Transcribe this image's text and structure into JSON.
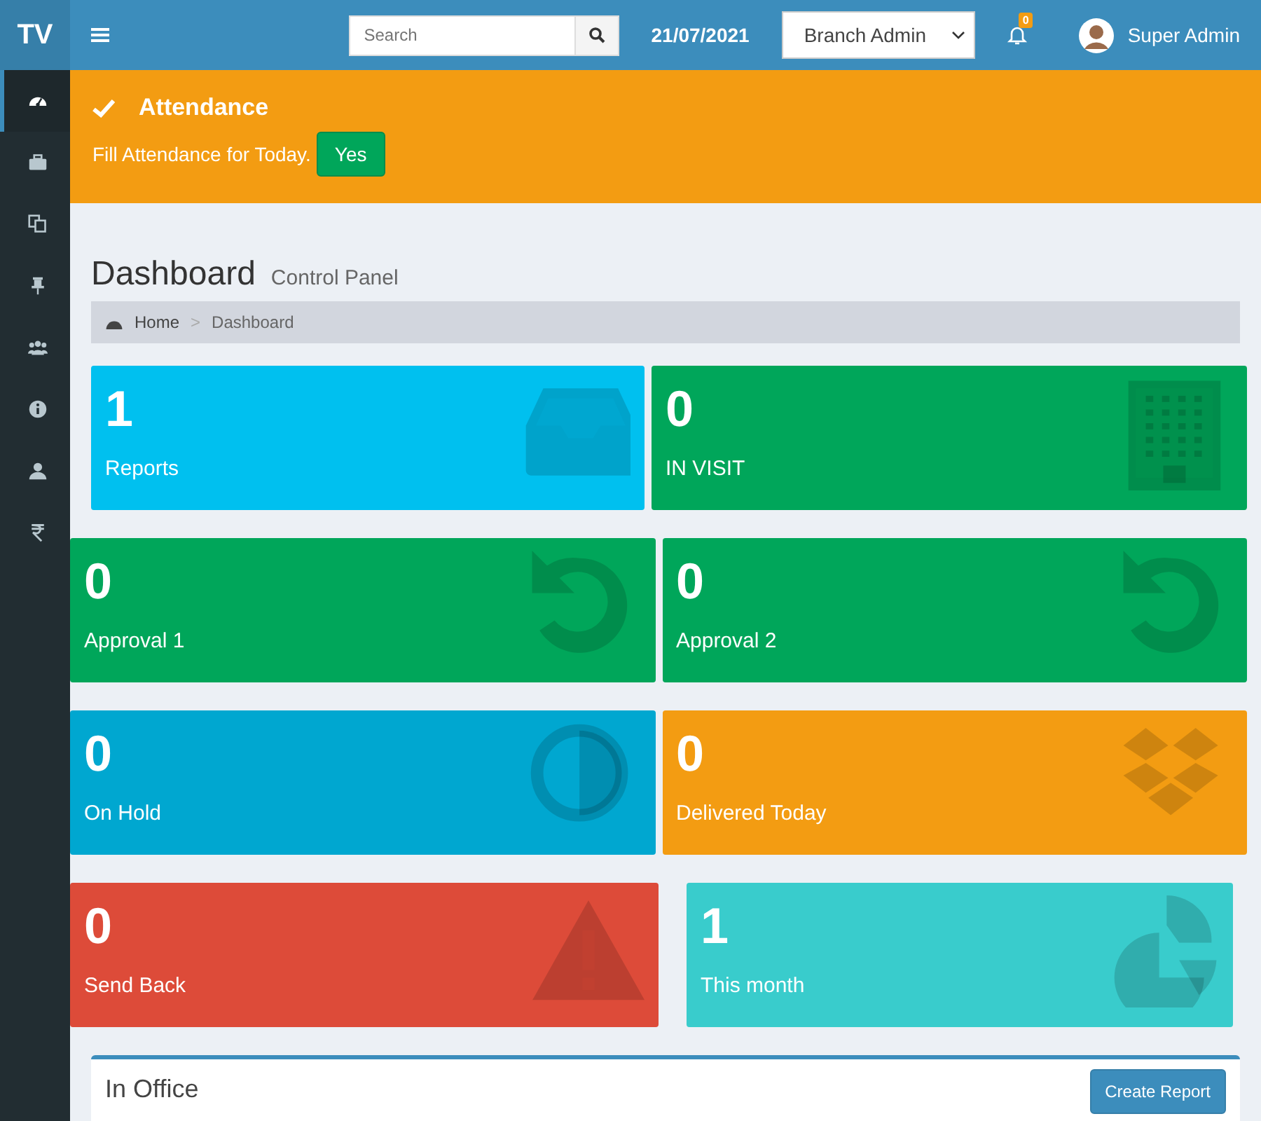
{
  "header": {
    "logo": "TV",
    "search": {
      "placeholder": "Search"
    },
    "date": "21/07/2021",
    "role_select": {
      "value": "Branch Admin"
    },
    "notifications": {
      "count": "0"
    },
    "user": {
      "name": "Super Admin"
    }
  },
  "sidebar": {
    "items": [
      {
        "kind": "dashboard",
        "selected": true
      },
      {
        "kind": "briefcase",
        "selected": false
      },
      {
        "kind": "copy",
        "selected": false
      },
      {
        "kind": "pin",
        "selected": false
      },
      {
        "kind": "users",
        "selected": false
      },
      {
        "kind": "info",
        "selected": false
      },
      {
        "kind": "user",
        "selected": false
      },
      {
        "kind": "rupee",
        "selected": false
      }
    ]
  },
  "attendance": {
    "title": "Attendance",
    "message": "Fill Attendance for Today.",
    "button": "Yes"
  },
  "page": {
    "title": "Dashboard",
    "subtitle": "Control Panel"
  },
  "breadcrumb": [
    "Home",
    ">",
    "Dashboard"
  ],
  "cards": [
    {
      "count": "1",
      "label": "Reports",
      "kind": "inbox",
      "color": "#00c0ef"
    },
    {
      "count": "0",
      "label": "IN VISIT",
      "kind": "building",
      "color": "#00a65a"
    },
    {
      "count": "0",
      "label": "Approval 1",
      "kind": "undo",
      "color": "#00a65a"
    },
    {
      "count": "0",
      "label": "Approval 2",
      "kind": "undo",
      "color": "#00a65a"
    },
    {
      "count": "0",
      "label": "On Hold",
      "kind": "adjust",
      "color": "#00a7d0"
    },
    {
      "count": "0",
      "label": "Delivered Today",
      "kind": "boxes",
      "color": "#f39c12"
    },
    {
      "count": "0",
      "label": "Send Back",
      "kind": "warning",
      "color": "#dd4b39"
    },
    {
      "count": "1",
      "label": "This month",
      "kind": "pie",
      "color": "#39cccc"
    }
  ],
  "panel": {
    "title": "In Office",
    "button": "Create Report"
  }
}
